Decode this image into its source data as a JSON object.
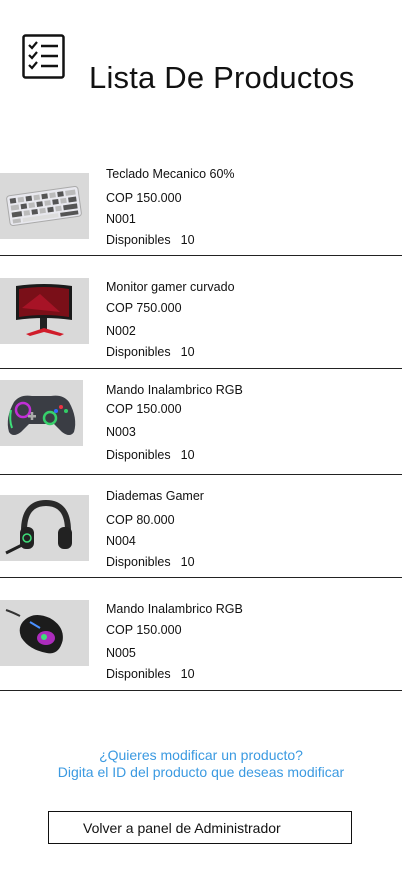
{
  "header": {
    "title": "Lista De Productos",
    "icon": "checklist-icon"
  },
  "products": [
    {
      "name": "Teclado Mecanico 60%",
      "price": "COP 150.000",
      "id": "N001",
      "stock_label": "Disponibles",
      "stock": "10",
      "image": "keyboard-image"
    },
    {
      "name": "Monitor gamer curvado",
      "price": "COP 750.000",
      "id": "N002",
      "stock_label": "Disponibles",
      "stock": "10",
      "image": "monitor-image"
    },
    {
      "name": "Mando Inalambrico RGB",
      "price": "COP 150.000",
      "id": "N003",
      "stock_label": "Disponibles",
      "stock": "10",
      "image": "gamepad-image"
    },
    {
      "name": "Diademas Gamer",
      "price": "COP 80.000",
      "id": "N004",
      "stock_label": "Disponibles",
      "stock": "10",
      "image": "headset-image"
    },
    {
      "name": "Mando Inalambrico RGB",
      "price": "COP 150.000",
      "id": "N005",
      "stock_label": "Disponibles",
      "stock": "10",
      "image": "mouse-image"
    }
  ],
  "modify_prompt": {
    "line1": "¿Quieres modificar un producto?",
    "line2": "Digita el ID del producto que deseas modificar",
    "color": "#3b9ae1"
  },
  "admin_button": {
    "label": "Volver a panel de Administrador"
  }
}
